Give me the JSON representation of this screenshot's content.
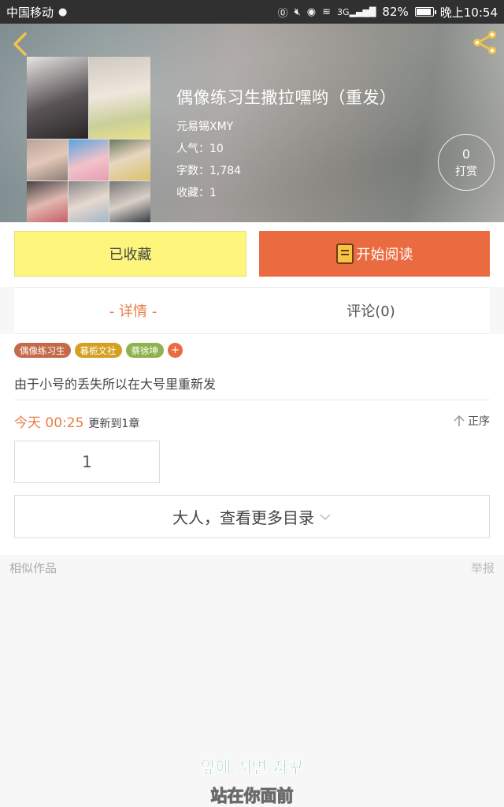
{
  "statusbar": {
    "carrier": "中国移动",
    "battery_percent": "82%",
    "battery_level": 0.82,
    "signal": "3G",
    "time": "晚上10:54"
  },
  "header": {
    "back_icon": "chevron-left-icon",
    "share_icon": "share-icon"
  },
  "book": {
    "title": "偶像练习生撒拉嘿哟（重发）",
    "author": "元易锡XMY",
    "popularity_label": "人气：",
    "popularity": "10",
    "word_count_label": "字数：",
    "word_count": "1,784",
    "favorites_label": "收藏：",
    "favorites": "1",
    "tip_count": "0",
    "tip_label": "打赏"
  },
  "actions": {
    "collect_label": "已收藏",
    "read_label": "开始阅读"
  },
  "tabs": [
    {
      "label": "- 详情 -",
      "active": true
    },
    {
      "label": "评论(0)",
      "active": false
    }
  ],
  "tags": [
    {
      "label": "偶像练习生",
      "color": "#c46a4a"
    },
    {
      "label": "暮栀文社",
      "color": "#d5a021"
    },
    {
      "label": "蔡徐坤",
      "color": "#8db24e"
    }
  ],
  "tag_add": "+",
  "description": "由于小号的丢失所以在大号里重新发",
  "update": {
    "time": "今天 00:25",
    "text": "更新到1章",
    "sort_label": "正序"
  },
  "chapter": "1",
  "more_catalog": "大人，查看更多目录",
  "similar_label": "相似作品",
  "report_label": "举报",
  "subtitles": {
    "korean": "앞에 서면 자꾸",
    "chinese": "站在你面前"
  },
  "colors": {
    "accent": "#ea6b3f",
    "collect_bg": "#fdf57c",
    "tab_active": "#ea7c46"
  }
}
